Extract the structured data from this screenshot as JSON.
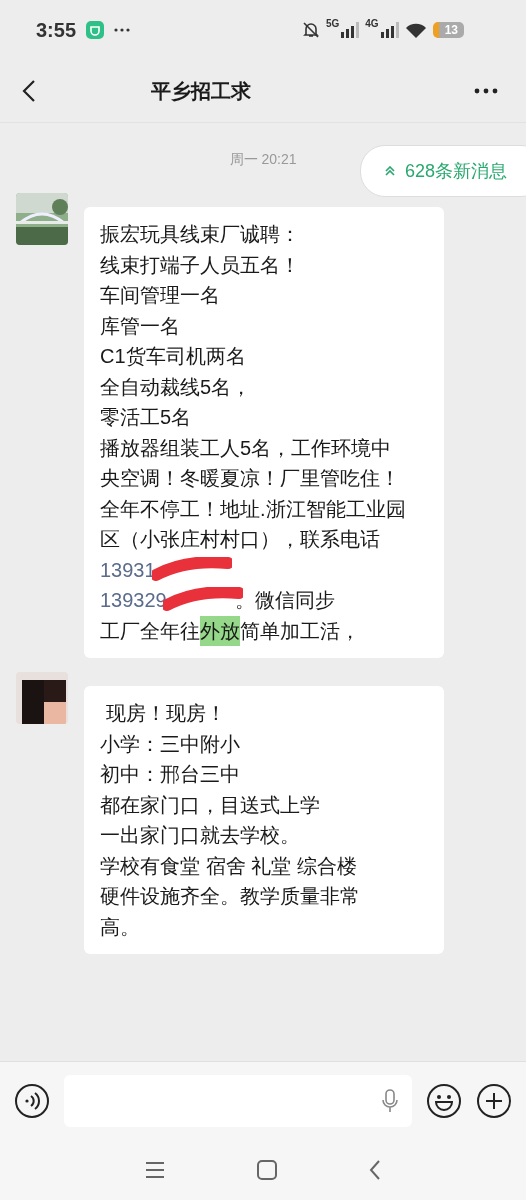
{
  "status_bar": {
    "time": "3:55",
    "network_1": "5G",
    "network_2": "4G",
    "battery": "13"
  },
  "header": {
    "title": "平乡招工求"
  },
  "new_messages": "628条新消息",
  "timestamp": "周一 20:21",
  "messages": [
    {
      "avatar": {
        "kind": "picture"
      },
      "lines": [
        [
          {
            "kind": "plain",
            "text": "振宏玩具线束厂诚聘："
          }
        ],
        [
          {
            "kind": "plain",
            "text": "线束打端子人员五名！"
          }
        ],
        [
          {
            "kind": "plain",
            "text": "车间管理一名"
          }
        ],
        [
          {
            "kind": "plain",
            "text": "库管一名"
          }
        ],
        [
          {
            "kind": "plain",
            "text": "C1货车司机两名"
          }
        ],
        [
          {
            "kind": "plain",
            "text": "全自动裁线5名，"
          }
        ],
        [
          {
            "kind": "plain",
            "text": "零活工5名"
          }
        ],
        [
          {
            "kind": "plain",
            "text": "播放器组装工人5名，工作环境中"
          }
        ],
        [
          {
            "kind": "plain",
            "text": "央空调！冬暖夏凉！厂里管吃住！"
          }
        ],
        [
          {
            "kind": "plain",
            "text": "全年不停工！地址.浙江智能工业园"
          }
        ],
        [
          {
            "kind": "plain",
            "text": "区（小张庄村村口），联系电话"
          }
        ],
        [
          {
            "kind": "link",
            "text": "13931"
          },
          {
            "kind": "redacted"
          }
        ],
        [
          {
            "kind": "link",
            "text": "139329"
          },
          {
            "kind": "redacted"
          },
          {
            "kind": "plain",
            "text": "。微信同步"
          }
        ],
        [
          {
            "kind": "plain",
            "text": "工厂全年往"
          },
          {
            "kind": "highlight",
            "text": "外放"
          },
          {
            "kind": "plain",
            "text": "简单加工活，"
          }
        ]
      ]
    },
    {
      "avatar": {
        "kind": "picture"
      },
      "lines": [
        [
          {
            "kind": "plain",
            "text": " 现房！现房！"
          }
        ],
        [
          {
            "kind": "plain",
            "text": "小学：三中附小"
          }
        ],
        [
          {
            "kind": "plain",
            "text": "初中：邢台三中"
          }
        ],
        [
          {
            "kind": "plain",
            "text": "都在家门口，目送式上学"
          }
        ],
        [
          {
            "kind": "plain",
            "text": "一出家门口就去学校。"
          }
        ],
        [
          {
            "kind": "plain",
            "text": "学校有食堂 宿舍 礼堂 综合楼"
          }
        ],
        [
          {
            "kind": "plain",
            "text": "硬件设施齐全。教学质量非常"
          }
        ],
        [
          {
            "kind": "plain",
            "text": "高。"
          }
        ]
      ]
    }
  ]
}
